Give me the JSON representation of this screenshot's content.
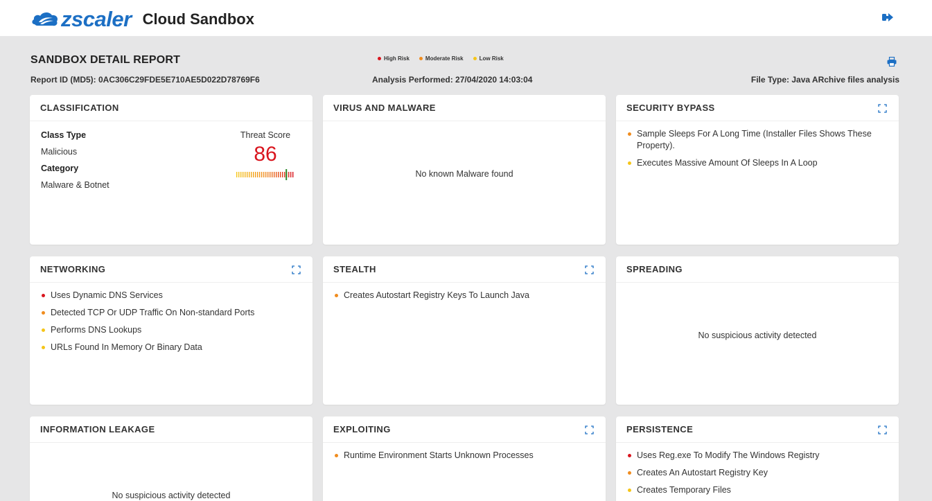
{
  "header": {
    "logo_text": "zscaler",
    "app_title": "Cloud Sandbox",
    "brand_color": "#1c6fc4",
    "logout_icon": "sign-out-icon"
  },
  "report": {
    "title": "SANDBOX DETAIL REPORT",
    "report_id": "Report ID (MD5): 0AC306C29FDE5E710AE5D022D78769F6",
    "analysis": "Analysis Performed: 27/04/2020 14:03:04",
    "file_type": "File Type: Java ARchive files analysis",
    "print_icon": "print-icon",
    "legend": [
      {
        "label": "High Risk",
        "color": "#d9151e"
      },
      {
        "label": "Moderate Risk",
        "color": "#f08c1e"
      },
      {
        "label": "Low Risk",
        "color": "#f5c518"
      }
    ]
  },
  "cards": {
    "classification": {
      "title": "CLASSIFICATION",
      "class_type_label": "Class Type",
      "class_type_value": "Malicious",
      "category_label": "Category",
      "category_value": "Malware & Botnet",
      "threat_score_label": "Threat Score",
      "threat_score": "86",
      "threat_score_fraction": 0.86
    },
    "virus": {
      "title": "VIRUS AND MALWARE",
      "empty_text": "No known Malware found"
    },
    "security_bypass": {
      "title": "SECURITY BYPASS",
      "items": [
        {
          "text": "Sample Sleeps For A Long Time (Installer Files Shows These Property).",
          "risk": "moderate"
        },
        {
          "text": "Executes Massive Amount Of Sleeps In A Loop",
          "risk": "low"
        }
      ]
    },
    "networking": {
      "title": "NETWORKING",
      "items": [
        {
          "text": "Uses Dynamic DNS Services",
          "risk": "high"
        },
        {
          "text": "Detected TCP Or UDP Traffic On Non-standard Ports",
          "risk": "moderate"
        },
        {
          "text": "Performs DNS Lookups",
          "risk": "low"
        },
        {
          "text": "URLs Found In Memory Or Binary Data",
          "risk": "low"
        }
      ]
    },
    "stealth": {
      "title": "STEALTH",
      "items": [
        {
          "text": "Creates Autostart Registry Keys To Launch Java",
          "risk": "moderate"
        }
      ]
    },
    "spreading": {
      "title": "SPREADING",
      "empty_text": "No suspicious activity detected"
    },
    "information_leakage": {
      "title": "INFORMATION LEAKAGE",
      "empty_text": "No suspicious activity detected"
    },
    "exploiting": {
      "title": "EXPLOITING",
      "items": [
        {
          "text": "Runtime Environment Starts Unknown Processes",
          "risk": "moderate"
        }
      ]
    },
    "persistence": {
      "title": "PERSISTENCE",
      "items": [
        {
          "text": "Uses Reg.exe To Modify The Windows Registry",
          "risk": "high"
        },
        {
          "text": "Creates An Autostart Registry Key",
          "risk": "moderate"
        },
        {
          "text": "Creates Temporary Files",
          "risk": "low"
        }
      ]
    }
  }
}
